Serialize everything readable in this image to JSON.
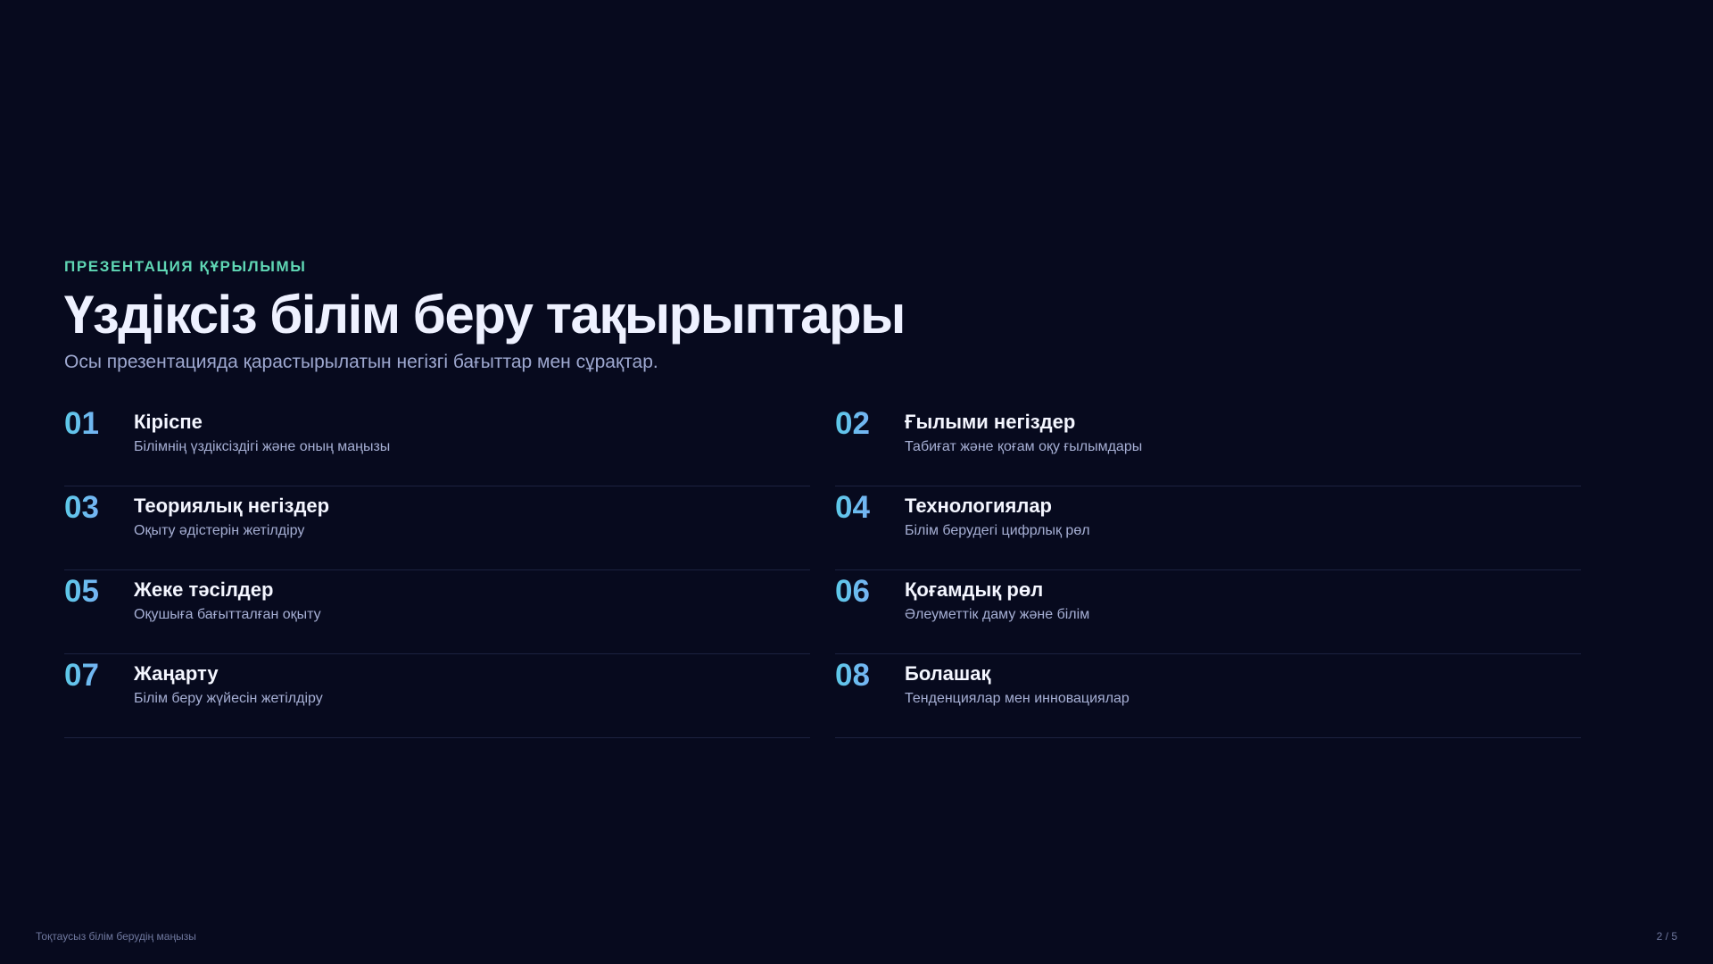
{
  "header": {
    "eyebrow": "ПРЕЗЕНТАЦИЯ ҚҰРЫЛЫМЫ",
    "title": "Үздіксіз білім беру тақырыптары",
    "subtitle": "Осы презентацияда қарастырылатын негізгі бағыттар мен сұрақтар."
  },
  "topics": [
    {
      "num": "01",
      "title": "Кіріспе",
      "desc": "Білімнің үздіксіздігі және оның маңызы"
    },
    {
      "num": "02",
      "title": "Ғылыми негіздер",
      "desc": "Табиғат және қоғам оқу ғылымдары"
    },
    {
      "num": "03",
      "title": "Теориялық негіздер",
      "desc": "Оқыту әдістерін жетілдіру"
    },
    {
      "num": "04",
      "title": "Технологиялар",
      "desc": "Білім берудегі цифрлық рөл"
    },
    {
      "num": "05",
      "title": "Жеке тәсілдер",
      "desc": "Оқушыға бағытталған оқыту"
    },
    {
      "num": "06",
      "title": "Қоғамдық рөл",
      "desc": "Әлеуметтік даму және білім"
    },
    {
      "num": "07",
      "title": "Жаңарту",
      "desc": "Білім беру жүйесін жетілдіру"
    },
    {
      "num": "08",
      "title": "Болашақ",
      "desc": "Тенденциялар мен инновациялар"
    }
  ],
  "footer": {
    "left": "Тоқтаусыз білім берудің маңызы",
    "page": "2 / 5"
  },
  "colors": {
    "background": "#070a1e",
    "accent": "#5fd6b4",
    "number_gradient_start": "#5cc9e8",
    "number_gradient_end": "#8f9dff"
  }
}
